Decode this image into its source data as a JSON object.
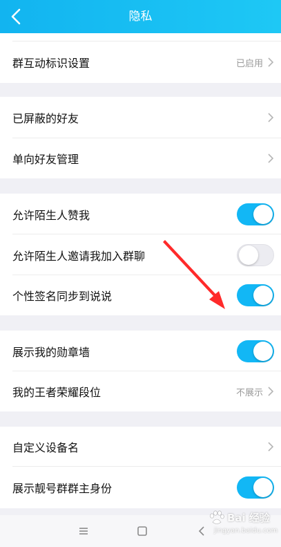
{
  "header": {
    "title": "隐私"
  },
  "rows": [
    {
      "label": "群互动标识设置",
      "value": "已启用"
    },
    {
      "label": "已屏蔽的好友"
    },
    {
      "label": "单向好友管理"
    },
    {
      "label": "允许陌生人赞我",
      "toggle": "on"
    },
    {
      "label": "允许陌生人邀请我加入群聊",
      "toggle": "off"
    },
    {
      "label": "个性签名同步到说说",
      "toggle": "on"
    },
    {
      "label": "展示我的勋章墙",
      "toggle": "on"
    },
    {
      "label": "我的王者荣耀段位",
      "value": "不展示"
    },
    {
      "label": "自定义设备名"
    },
    {
      "label": "展示靓号群群主身份",
      "toggle": "on"
    }
  ],
  "navbar": {
    "icons": [
      "menu-icon",
      "home-square-icon",
      "back-triangle-icon"
    ]
  },
  "watermark": {
    "text": "Bai 经验",
    "sub": "jingyan.baidu.com"
  },
  "colors": {
    "header": "#12b4f0",
    "toggle_on": "#12b7f5",
    "annotation_arrow": "#ff2a2a"
  }
}
